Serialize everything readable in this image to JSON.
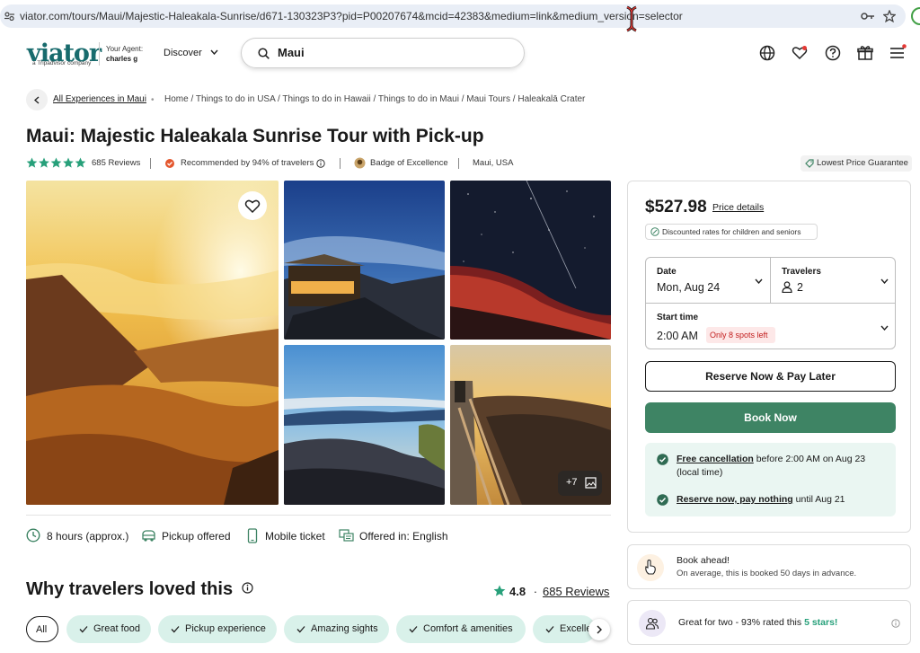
{
  "browser": {
    "url": "viator.com/tours/Maui/Majestic-Haleakala-Sunrise/d671-130323P3?pid=P00207674&mcid=42383&medium=link&medium_version=selector"
  },
  "header": {
    "logo": "viator",
    "logo_sub": "a Tripadvisor company",
    "agent_label": "Your Agent:",
    "agent_name": "charles g",
    "discover": "Discover",
    "search_value": "Maui"
  },
  "breadcrumb": {
    "all": "All Experiences in Maui",
    "path": "Home / Things to do in USA / Things to do in Hawaii / Things to do in Maui / Maui Tours / Haleakalā Crater"
  },
  "product": {
    "title": "Maui: Majestic Haleakala Sunrise Tour with Pick-up",
    "reviews": "685 Reviews",
    "recommended": "Recommended by 94% of travelers",
    "badge": "Badge of Excellence",
    "location": "Maui, USA",
    "lowest_price": "Lowest Price Guarantee",
    "more_photos": "+7"
  },
  "features": {
    "duration": "8 hours (approx.)",
    "pickup": "Pickup offered",
    "ticket": "Mobile ticket",
    "language": "Offered in: English"
  },
  "why": {
    "title": "Why travelers loved this",
    "rating": "4.8",
    "dot": "·",
    "reviews": "685 Reviews",
    "chips": [
      "All",
      "Great food",
      "Pickup experience",
      "Amazing sights",
      "Comfort & amenities",
      "Excelle"
    ]
  },
  "booking": {
    "price": "$527.98",
    "price_details": "Price details",
    "discount": "Discounted rates for children and seniors",
    "date_label": "Date",
    "date_value": "Mon, Aug 24",
    "travelers_label": "Travelers",
    "travelers_value": "2",
    "start_label": "Start time",
    "start_value": "2:00 AM",
    "spots": "Only 8 spots left",
    "reserve": "Reserve Now & Pay Later",
    "book": "Book Now",
    "cancel_link": "Free cancellation",
    "cancel_rest": " before 2:00 AM on Aug 23 (local time)",
    "reserve_link": "Reserve now, pay nothing",
    "reserve_rest": " until Aug 21"
  },
  "book_ahead": {
    "title": "Book ahead!",
    "text": "On average, this is booked 50 days in advance."
  },
  "great_for_two": {
    "text": "Great for two - 93% rated this ",
    "highlight": "5 stars!"
  },
  "colors": {
    "brand": "#186b6d",
    "book_button": "#3e8464",
    "star_green": "#27a07a",
    "chip_bg": "#d9f1ea",
    "spots_red": "#c21d1d"
  }
}
